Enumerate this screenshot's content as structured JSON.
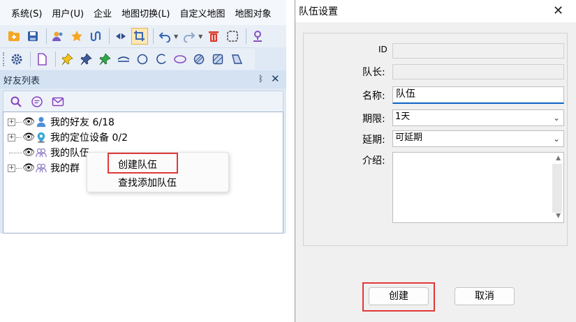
{
  "menubar": {
    "items": [
      "系统(S)",
      "用户(U)",
      "企业",
      "地图切换(L)",
      "自定义地图",
      "地图对象"
    ]
  },
  "toolbar1": {
    "icons": [
      "folder-add-icon",
      "save-icon",
      "users-icon",
      "star-icon",
      "route-icon",
      "layers-icon",
      "crop-icon",
      "undo-icon",
      "redo-icon",
      "delete-icon",
      "select-rect-icon",
      "map-pin-icon"
    ]
  },
  "toolbar2": {
    "icons": [
      "settings-icon",
      "document-icon",
      "pin-yellow-icon",
      "pin-blue-icon",
      "pin-green-icon",
      "arc-line-icon",
      "circle-icon",
      "arc-icon",
      "ellipse-icon",
      "hatched-circle-icon",
      "hatched-square-icon",
      "polygon-icon"
    ]
  },
  "panel": {
    "title": "好友列表",
    "pin_glyph": "ᛒ",
    "close_glyph": "✕",
    "tools": [
      "search-icon",
      "chat-icon",
      "mail-icon"
    ]
  },
  "tree": {
    "nodes": [
      {
        "label": "我的好友 6/18",
        "expander": "+",
        "icon": "person-icon"
      },
      {
        "label": "我的定位设备 0/2",
        "expander": "+",
        "icon": "location-device-icon"
      },
      {
        "label": "我的队伍",
        "expander": "",
        "icon": "team-icon"
      },
      {
        "label": "我的群",
        "expander": "+",
        "icon": "group-icon"
      }
    ]
  },
  "context_menu": {
    "items": [
      "创建队伍",
      "查找添加队伍"
    ]
  },
  "dialog": {
    "title": "队伍设置",
    "close_glyph": "✕",
    "fields": {
      "id_label": "ID",
      "leader_label": "队长:",
      "name_label": "名称:",
      "name_value": "队伍",
      "duration_label": "期限:",
      "duration_value": "1天",
      "extend_label": "延期:",
      "extend_value": "可延期",
      "intro_label": "介绍:"
    },
    "buttons": {
      "create": "创建",
      "cancel": "取消"
    }
  },
  "colors": {
    "highlight": "#e03838",
    "focus_underline": "#0b63c4",
    "panel_header": "#d4e2f2"
  }
}
